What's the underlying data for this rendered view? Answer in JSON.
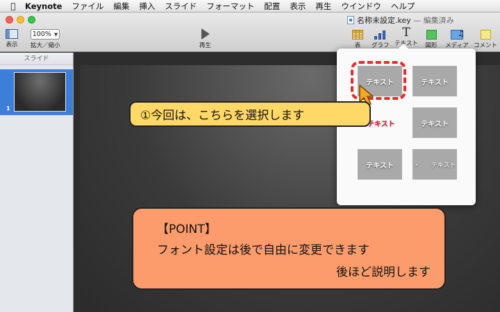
{
  "menubar": {
    "apple_icon": "apple-icon",
    "app_name": "Keynote",
    "items": [
      "ファイル",
      "編集",
      "挿入",
      "スライド",
      "フォーマット",
      "配置",
      "表示",
      "再生",
      "ウインドウ",
      "ヘルプ"
    ]
  },
  "window": {
    "doc_name": "名称未設定.key",
    "doc_status": "— 編集済み"
  },
  "toolbar": {
    "view_label": "表示",
    "zoom_value": "100%",
    "zoom_label": "拡大／縮小",
    "play_label": "再生",
    "table_label": "表",
    "chart_label": "グラフ",
    "text_label": "テキスト",
    "text_icon_glyph": "T",
    "shape_label": "図形",
    "media_label": "メディア",
    "comment_label": "コメント"
  },
  "sidebar": {
    "header": "スライド",
    "slide_number": "1"
  },
  "popover": {
    "styles": [
      "テキスト",
      "テキスト",
      "テキスト",
      "テキスト",
      "テキスト",
      "テキスト"
    ],
    "tile6_prefix": "・"
  },
  "callouts": {
    "select_note": "①今回は、こちらを選択します",
    "point_title": "【POINT】",
    "point_line1": "フォント設定は後で自由に変更できます",
    "point_line2": "後ほど説明します"
  },
  "colors": {
    "highlight_ring": "#e8282b",
    "callout_yellow": "#ffd868",
    "callout_orange": "#fc9c6c",
    "selection_blue": "#3d7ed8",
    "cursor_orange": "#f7a823"
  }
}
